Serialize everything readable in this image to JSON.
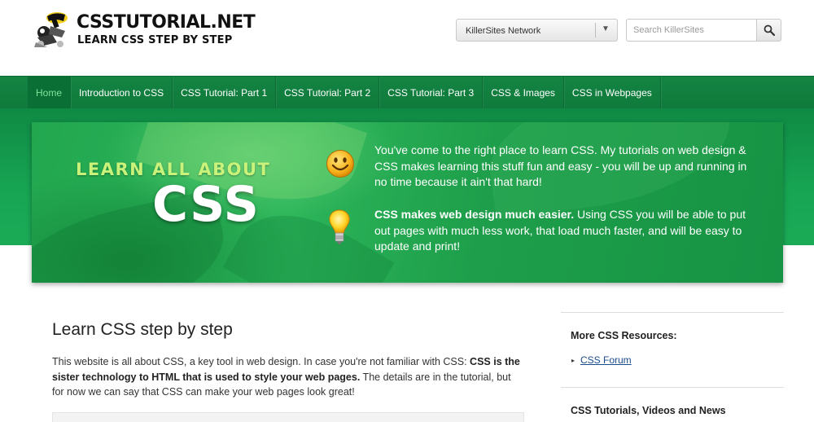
{
  "header": {
    "brand_title": "CSSTUTORIAL.NET",
    "brand_subtitle": "LEARN CSS STEP BY STEP",
    "network_select": "KillerSites Network",
    "search_placeholder": "Search KillerSites"
  },
  "nav": {
    "items": [
      {
        "label": "Home",
        "active": true
      },
      {
        "label": "Introduction to CSS"
      },
      {
        "label": "CSS Tutorial: Part 1"
      },
      {
        "label": "CSS Tutorial: Part 2"
      },
      {
        "label": "CSS Tutorial: Part 3"
      },
      {
        "label": "CSS & Images"
      },
      {
        "label": "CSS in Webpages"
      }
    ]
  },
  "hero": {
    "kicker": "LEARN ALL ABOUT",
    "big": "CSS",
    "p1": "You've come to the right place to learn CSS. My tutorials on web design & CSS makes learning this stuff fun and easy - you will be up and running in no time because it ain't that hard!",
    "p2_bold": "CSS makes web design much easier.",
    "p2_rest": " Using CSS you will be able to put out pages with much less work, that load much faster, and will be easy to update and print!"
  },
  "main": {
    "title": "Learn CSS step by step",
    "intro_a": "This website is all about CSS, a key tool in web design. In case you're not familiar with CSS: ",
    "intro_bold": "CSS is the sister technology to HTML that is used to style your web pages.",
    "intro_b": " The details are in the tutorial, but for now we can say that CSS can make your web pages look great!"
  },
  "sidebar": {
    "resources_title": "More CSS Resources:",
    "resources_links": [
      "CSS Forum"
    ],
    "videos_title": "CSS Tutorials, Videos and News"
  },
  "colors": {
    "nav_bg": "#148443",
    "nav_active_text": "#7fe39a",
    "hero_kicker": "#c9f27a",
    "link": "#1a4b8c"
  },
  "icons": [
    "logo-mascot",
    "chevron-down-icon",
    "search-icon",
    "smiley-icon",
    "lightbulb-icon",
    "bullet-icon"
  ]
}
